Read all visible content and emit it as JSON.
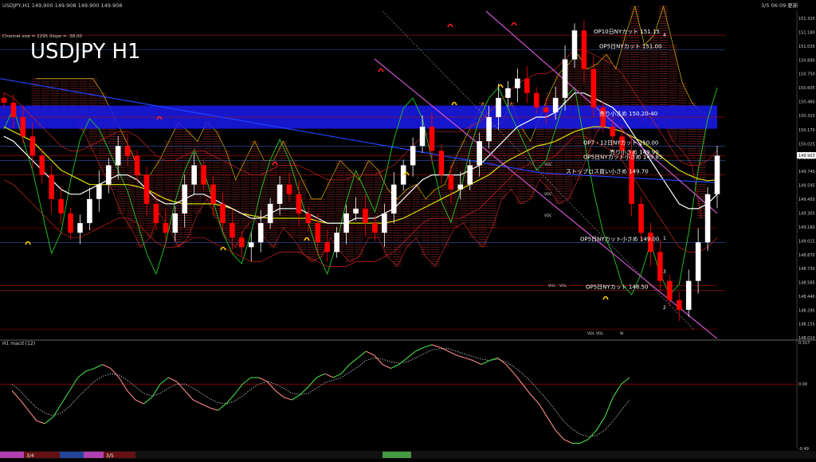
{
  "header": {
    "symbol_line": "USDJPY,H1  149.900 149.908 149.900 149.908",
    "channel_info": "Channel size = 2295  Slope = -38.00",
    "big_title": "USDJPY H1",
    "timestamp": "3/5 06:09 更新",
    "macd_label": "H1  macd (12)"
  },
  "colors": {
    "background": "#000000",
    "bull_candle": "#ffffff",
    "bear_candle": "#ff0000",
    "grid_red": "#aa0000",
    "blue_line": "#2244ff",
    "yellow_ma": "#e0e000",
    "white_ma": "#ffffff",
    "green_osc": "#22cc22",
    "magenta_channel": "#cc55cc",
    "ichimoku_cloud": "#aa3333",
    "resistance_band": "#1a1aee",
    "macd_main": "#44dd44",
    "macd_signal": "#cccccc",
    "macd_down": "#ff8888"
  },
  "chart_data": [
    {
      "type": "line",
      "title": "USDJPY H1",
      "price_axis": {
        "ticks": [
          "151.325",
          "151.180",
          "151.035",
          "150.890",
          "150.750",
          "150.605",
          "150.460",
          "150.315",
          "150.170",
          "150.025",
          "149.880",
          "149.740",
          "149.595",
          "149.450",
          "149.305",
          "149.160",
          "149.015",
          "148.870",
          "148.730",
          "148.585",
          "148.440",
          "148.295",
          "148.155",
          "148.010"
        ],
        "current_price_tag": "149.903",
        "ylim": [
          148.01,
          151.4
        ]
      },
      "series": [
        {
          "name": "close",
          "values": [
            150.45,
            150.3,
            150.1,
            149.9,
            149.7,
            149.45,
            149.3,
            149.1,
            149.2,
            149.45,
            149.6,
            149.8,
            150.0,
            149.9,
            149.7,
            149.4,
            149.2,
            149.1,
            149.3,
            149.6,
            149.8,
            149.6,
            149.4,
            149.2,
            149.05,
            148.95,
            149.0,
            149.2,
            149.4,
            149.6,
            149.5,
            149.3,
            149.2,
            149.0,
            148.9,
            149.1,
            149.3,
            149.35,
            149.2,
            149.1,
            149.3,
            149.6,
            149.8,
            150.0,
            150.2,
            149.95,
            149.7,
            149.55,
            149.6,
            149.8,
            150.05,
            150.3,
            150.5,
            150.6,
            150.7,
            150.55,
            150.4,
            150.35,
            150.5,
            150.9,
            151.2,
            150.8,
            150.4,
            150.2,
            150.1,
            149.95,
            149.4,
            149.1,
            148.9,
            148.6,
            148.4,
            148.3,
            148.6,
            149.0,
            149.5,
            149.9
          ]
        },
        {
          "name": "",
          "values": [
            150.1,
            150.05,
            149.95,
            149.85,
            149.75,
            149.65,
            149.55,
            149.5,
            149.5,
            149.55,
            149.6,
            149.65,
            149.7,
            149.7,
            149.65,
            149.55,
            149.45,
            149.4,
            149.4,
            149.45,
            149.5,
            149.5,
            149.45,
            149.4,
            149.35,
            149.3,
            149.25,
            149.25,
            149.3,
            149.35,
            149.35,
            149.35,
            149.3,
            149.25,
            149.2,
            149.2,
            149.2,
            149.25,
            149.25,
            149.25,
            149.3,
            149.35,
            149.45,
            149.55,
            149.65,
            149.7,
            149.7,
            149.7,
            149.7,
            149.75,
            149.8,
            149.9,
            150.0,
            150.1,
            150.2,
            150.25,
            150.3,
            150.3,
            150.35,
            150.45,
            150.55,
            150.55,
            150.5,
            150.45,
            150.4,
            150.3,
            150.15,
            150.0,
            149.85,
            149.7,
            149.55,
            149.4,
            149.35,
            149.35,
            149.4,
            149.5
          ]
        },
        {
          "name": "",
          "values": [
            150.2,
            150.15,
            150.1,
            150.05,
            149.95,
            149.85,
            149.75,
            149.7,
            149.65,
            149.6,
            149.6,
            149.6,
            149.6,
            149.6,
            149.58,
            149.55,
            149.5,
            149.45,
            149.42,
            149.4,
            149.4,
            149.4,
            149.4,
            149.38,
            149.35,
            149.3,
            149.28,
            149.26,
            149.25,
            149.25,
            149.25,
            149.25,
            149.25,
            149.22,
            149.2,
            149.2,
            149.2,
            149.2,
            149.2,
            149.2,
            149.2,
            149.22,
            149.25,
            149.3,
            149.35,
            149.4,
            149.45,
            149.5,
            149.55,
            149.6,
            149.65,
            149.7,
            149.78,
            149.85,
            149.9,
            149.95,
            150.0,
            150.02,
            150.05,
            150.1,
            150.15,
            150.18,
            150.2,
            150.2,
            150.18,
            150.15,
            150.1,
            150.05,
            149.98,
            149.9,
            149.82,
            149.75,
            149.7,
            149.66,
            149.64,
            149.65
          ]
        },
        {
          "name": "",
          "values": [
            0.6,
            0.8,
            0.5,
            0.2,
            -0.2,
            -0.6,
            -0.4,
            0.1,
            0.5,
            0.7,
            0.6,
            0.4,
            0.2,
            0.0,
            -0.3,
            -0.6,
            -0.8,
            -0.5,
            -0.1,
            0.2,
            0.4,
            0.2,
            -0.1,
            -0.4,
            -0.6,
            -0.7,
            -0.4,
            0.0,
            0.3,
            0.5,
            0.3,
            0.0,
            -0.3,
            -0.6,
            -0.8,
            -0.5,
            -0.1,
            0.2,
            0.0,
            -0.2,
            0.1,
            0.5,
            0.8,
            0.9,
            0.7,
            0.3,
            -0.1,
            -0.3,
            0.0,
            0.4,
            0.7,
            0.9,
            1.0,
            0.8,
            0.6,
            0.4,
            0.2,
            0.3,
            0.6,
            0.9,
            1.0,
            0.5,
            0.0,
            -0.4,
            -0.6,
            -0.9,
            -1.0,
            -0.8,
            -0.5,
            -0.8,
            -1.0,
            -0.9,
            -0.4,
            0.2,
            0.7,
            1.0
          ]
        }
      ],
      "annotations": [
        {
          "text": "OP10日NYカット 151.15",
          "price": 151.15
        },
        {
          "text": "OP5日NYカット 151.00",
          "price": 151.0
        },
        {
          "text": "売り小さめ 150.20-40",
          "price": 150.3
        },
        {
          "text": "OP7・12日NYカット 150.00",
          "price": 150.0
        },
        {
          "text": "売り小さめ 149.90",
          "price": 149.9
        },
        {
          "text": "OP5日NYカット小さめ 149.85",
          "price": 149.85
        },
        {
          "text": "ストップロス買い小さめ 149.70",
          "price": 149.7
        },
        {
          "text": "OP5日NYカット小さめ 149.00",
          "price": 149.0
        },
        {
          "text": "OP5日NYカット 148.50",
          "price": 148.5
        }
      ],
      "level_marks": [
        "1",
        "2",
        "3",
        "4"
      ],
      "small_labels": [
        "VDC",
        "VDC",
        "VDC",
        "VHL",
        "VHL",
        "VDL",
        "VDL",
        "W"
      ]
    },
    {
      "type": "line",
      "title": "H1  macd (12)",
      "axis_ticks": [
        "0.317",
        "0.00",
        "-0.49"
      ],
      "ylim": [
        -0.49,
        0.317
      ],
      "series": [
        {
          "name": "",
          "values": [
            -0.05,
            -0.12,
            -0.2,
            -0.28,
            -0.3,
            -0.25,
            -0.15,
            -0.05,
            0.05,
            0.1,
            0.12,
            0.15,
            0.12,
            0.05,
            -0.05,
            -0.12,
            -0.15,
            -0.1,
            0.0,
            0.05,
            0.02,
            -0.05,
            -0.12,
            -0.15,
            -0.18,
            -0.2,
            -0.15,
            -0.08,
            0.0,
            0.05,
            0.05,
            0.02,
            -0.05,
            -0.1,
            -0.12,
            -0.08,
            -0.02,
            0.05,
            0.08,
            0.05,
            0.08,
            0.15,
            0.2,
            0.25,
            0.22,
            0.15,
            0.12,
            0.15,
            0.2,
            0.25,
            0.28,
            0.3,
            0.28,
            0.25,
            0.22,
            0.2,
            0.18,
            0.15,
            0.18,
            0.2,
            0.15,
            0.08,
            0.0,
            -0.08,
            -0.15,
            -0.25,
            -0.35,
            -0.42,
            -0.45,
            -0.45,
            -0.42,
            -0.35,
            -0.25,
            -0.1,
            0.0,
            0.05
          ]
        },
        {
          "name": "",
          "values": [
            0.0,
            -0.05,
            -0.12,
            -0.18,
            -0.22,
            -0.24,
            -0.22,
            -0.17,
            -0.1,
            -0.04,
            0.02,
            0.06,
            0.08,
            0.07,
            0.03,
            -0.02,
            -0.07,
            -0.09,
            -0.07,
            -0.03,
            0.0,
            0.0,
            -0.03,
            -0.07,
            -0.11,
            -0.14,
            -0.15,
            -0.13,
            -0.09,
            -0.04,
            0.0,
            0.02,
            0.0,
            -0.03,
            -0.07,
            -0.08,
            -0.07,
            -0.03,
            0.01,
            0.03,
            0.05,
            0.09,
            0.13,
            0.18,
            0.2,
            0.19,
            0.17,
            0.16,
            0.17,
            0.2,
            0.23,
            0.26,
            0.27,
            0.27,
            0.25,
            0.23,
            0.21,
            0.19,
            0.18,
            0.19,
            0.17,
            0.13,
            0.08,
            0.02,
            -0.05,
            -0.12,
            -0.2,
            -0.28,
            -0.34,
            -0.38,
            -0.4,
            -0.39,
            -0.35,
            -0.28,
            -0.2,
            -0.12
          ]
        }
      ]
    }
  ],
  "footer": {
    "tabs": [
      "3/4",
      "3/5"
    ]
  }
}
